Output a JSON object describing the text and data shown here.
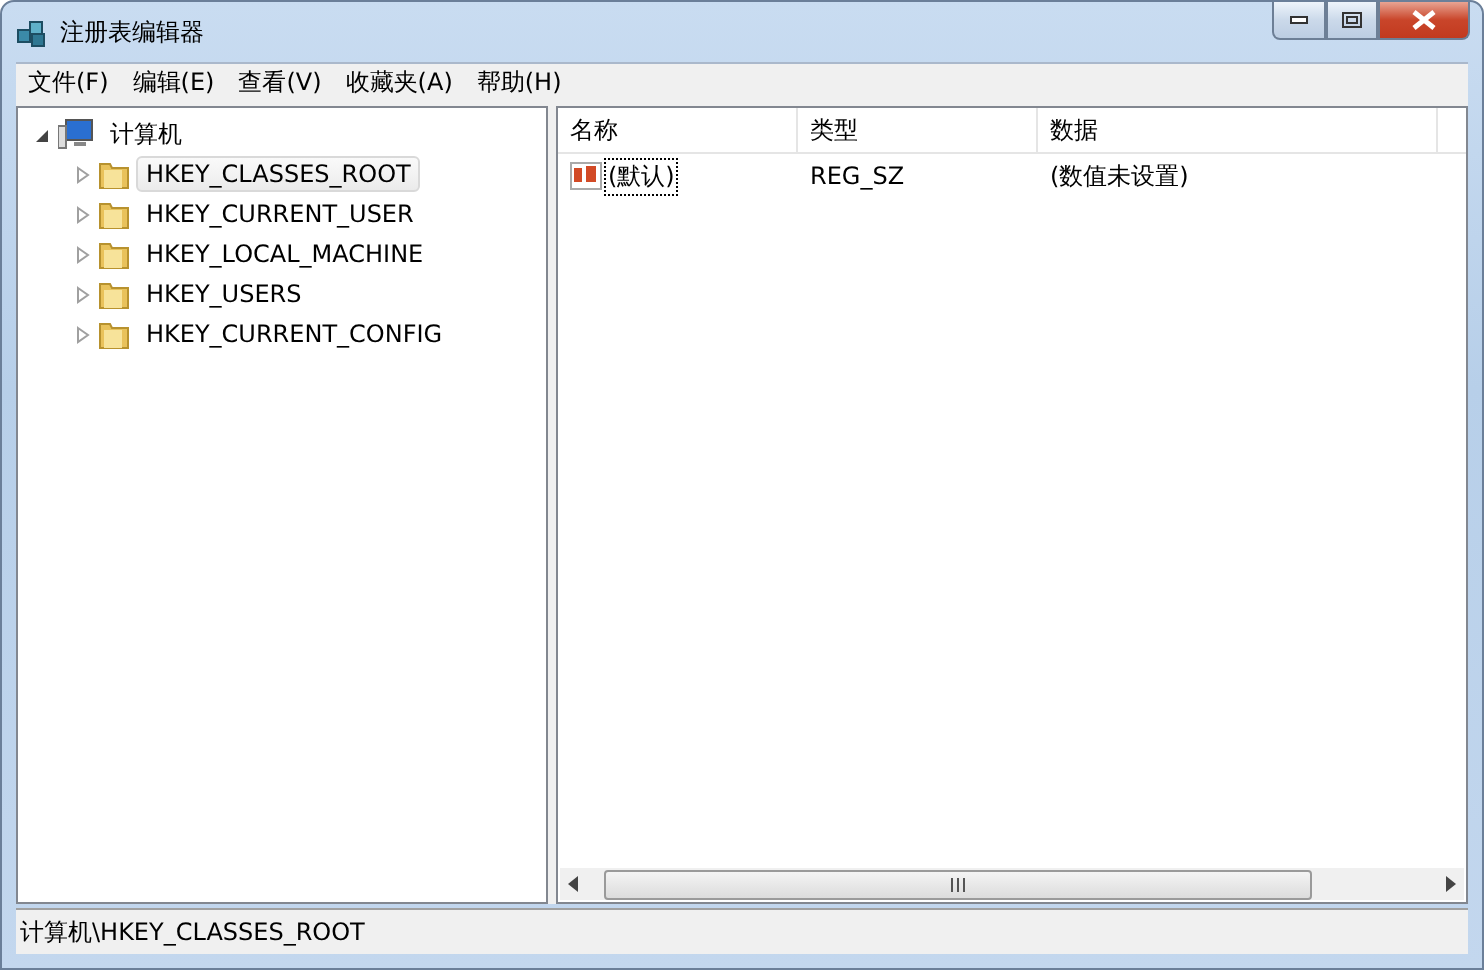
{
  "window": {
    "title": "注册表编辑器"
  },
  "menu": [
    "文件(F)",
    "编辑(E)",
    "查看(V)",
    "收藏夹(A)",
    "帮助(H)"
  ],
  "tree": {
    "label": "计算机",
    "expanded": true,
    "children": [
      {
        "label": "HKEY_CLASSES_ROOT",
        "selected": true,
        "expanded": false
      },
      {
        "label": "HKEY_CURRENT_USER",
        "selected": false,
        "expanded": false
      },
      {
        "label": "HKEY_LOCAL_MACHINE",
        "selected": false,
        "expanded": false
      },
      {
        "label": "HKEY_USERS",
        "selected": false,
        "expanded": false
      },
      {
        "label": "HKEY_CURRENT_CONFIG",
        "selected": false,
        "expanded": false
      }
    ]
  },
  "table": {
    "columns": [
      "名称",
      "类型",
      "数据"
    ],
    "rows": [
      {
        "name": "(默认)",
        "type": "REG_SZ",
        "data": "(数值未设置)",
        "focused": true
      }
    ]
  },
  "status_bar": "计算机\\HKEY_CLASSES_ROOT"
}
